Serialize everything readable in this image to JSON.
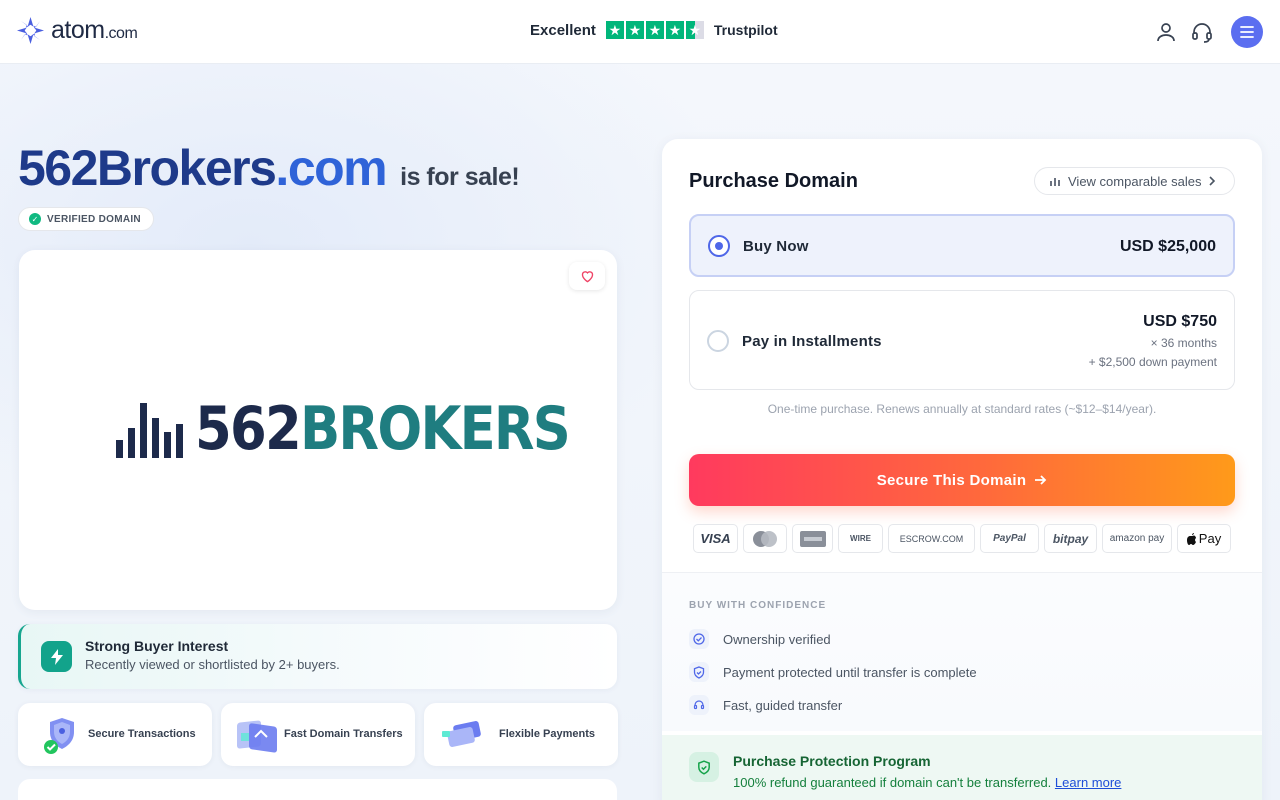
{
  "header": {
    "logo_main": "atom",
    "logo_suffix": ".com",
    "trust_rating_label": "Excellent",
    "trust_stars": 4.5,
    "trust_brand": "Trustpilot",
    "icons": [
      "user-icon",
      "headset-icon",
      "menu-icon"
    ]
  },
  "listing": {
    "domain_name": "562Brokers",
    "domain_tld": ".com",
    "for_sale_text": "is for sale!",
    "verified_badge": "VERIFIED DOMAIN",
    "brand_logo_number": "562",
    "brand_logo_word": "BROKERS",
    "interest_title": "Strong Buyer Interest",
    "interest_subtitle": "Recently viewed or shortlisted by 2+ buyers.",
    "features": [
      "Secure Transactions",
      "Fast Domain Transfers",
      "Flexible Payments"
    ]
  },
  "purchase": {
    "title": "Purchase Domain",
    "comparable_sales": "View comparable sales",
    "buy_now": {
      "label": "Buy Now",
      "price": "USD $25,000",
      "selected": true
    },
    "installments": {
      "label": "Pay in Installments",
      "price": "USD $750",
      "term": "× 36 months",
      "down_payment": "+ $2,500 down payment",
      "selected": false
    },
    "renewal_note": "One-time purchase. Renews annually at standard rates (~$12–$14/year).",
    "cta": "Secure This Domain",
    "payment_methods": [
      "VISA",
      "MasterCard",
      "American Express",
      "Wire Transfer",
      "ESCROW.COM",
      "PayPal",
      "bitpay",
      "amazon pay",
      "Apple Pay"
    ],
    "payment_method_labels": {
      "visa": "VISA",
      "wire": "WIRE",
      "escrow": "ESCROW.COM",
      "paypal": "PayPal",
      "bitpay": "bitpay",
      "amazon": "amazon pay",
      "apple": "Pay"
    }
  },
  "confidence": {
    "title": "BUY WITH CONFIDENCE",
    "items": [
      "Ownership verified",
      "Payment protected until transfer is complete",
      "Fast, guided transfer"
    ]
  },
  "protection": {
    "title": "Purchase Protection Program",
    "text": "100% refund guaranteed if domain can't be transferred.",
    "link": "Learn more"
  },
  "colors": {
    "accent": "#4f67e8",
    "trustpilot_green": "#00b67a",
    "cta_start": "#ff3a5e",
    "cta_end": "#ff9a1a",
    "brand_navy": "#1d2a4b",
    "brand_teal": "#1f7d80"
  }
}
